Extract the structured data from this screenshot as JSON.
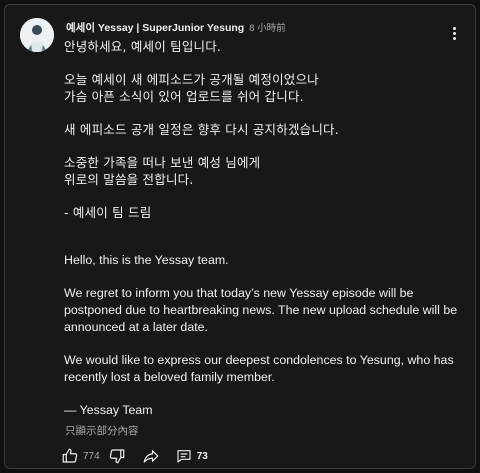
{
  "comment": {
    "author": "예세이 Yessay | SuperJunior Yesung",
    "time": "8 小時前",
    "korean_lines": {
      "greeting": "안녕하세요, 예세이 팀입니다.",
      "p1_l1": "오늘 예세이 새 에피소드가 공개될 예정이었으나",
      "p1_l2": "가슴 아픈 소식이 있어 업로드를 쉬어 갑니다.",
      "p2": "새 에피소드 공개 일정은 향후 다시 공지하겠습니다.",
      "p3_l1": "소중한 가족을 떠나 보낸 예성 님에게",
      "p3_l2": "위로의 말씀을 전합니다.",
      "sign": "- 예세이 팀 드림"
    },
    "english_lines": {
      "greeting": "Hello, this is the Yessay team.",
      "p1_l1": "We regret to inform you that today’s new Yessay episode will be",
      "p1_l2": "postponed due to heartbreaking news. The new upload schedule will be",
      "p1_l3": "announced at a later date.",
      "p2_l1": "We would like to express our deepest condolences to Yesung, who has",
      "p2_l2": "recently lost a beloved family member.",
      "sign": "— Yessay Team"
    },
    "see_less": "只顯示部分內容",
    "like_count": "774",
    "reply_count": "73"
  },
  "icons": {
    "more": "more-vertical-icon",
    "like": "thumbs-up-icon",
    "dislike": "thumbs-down-icon",
    "share": "share-icon",
    "replies": "comment-icon"
  }
}
